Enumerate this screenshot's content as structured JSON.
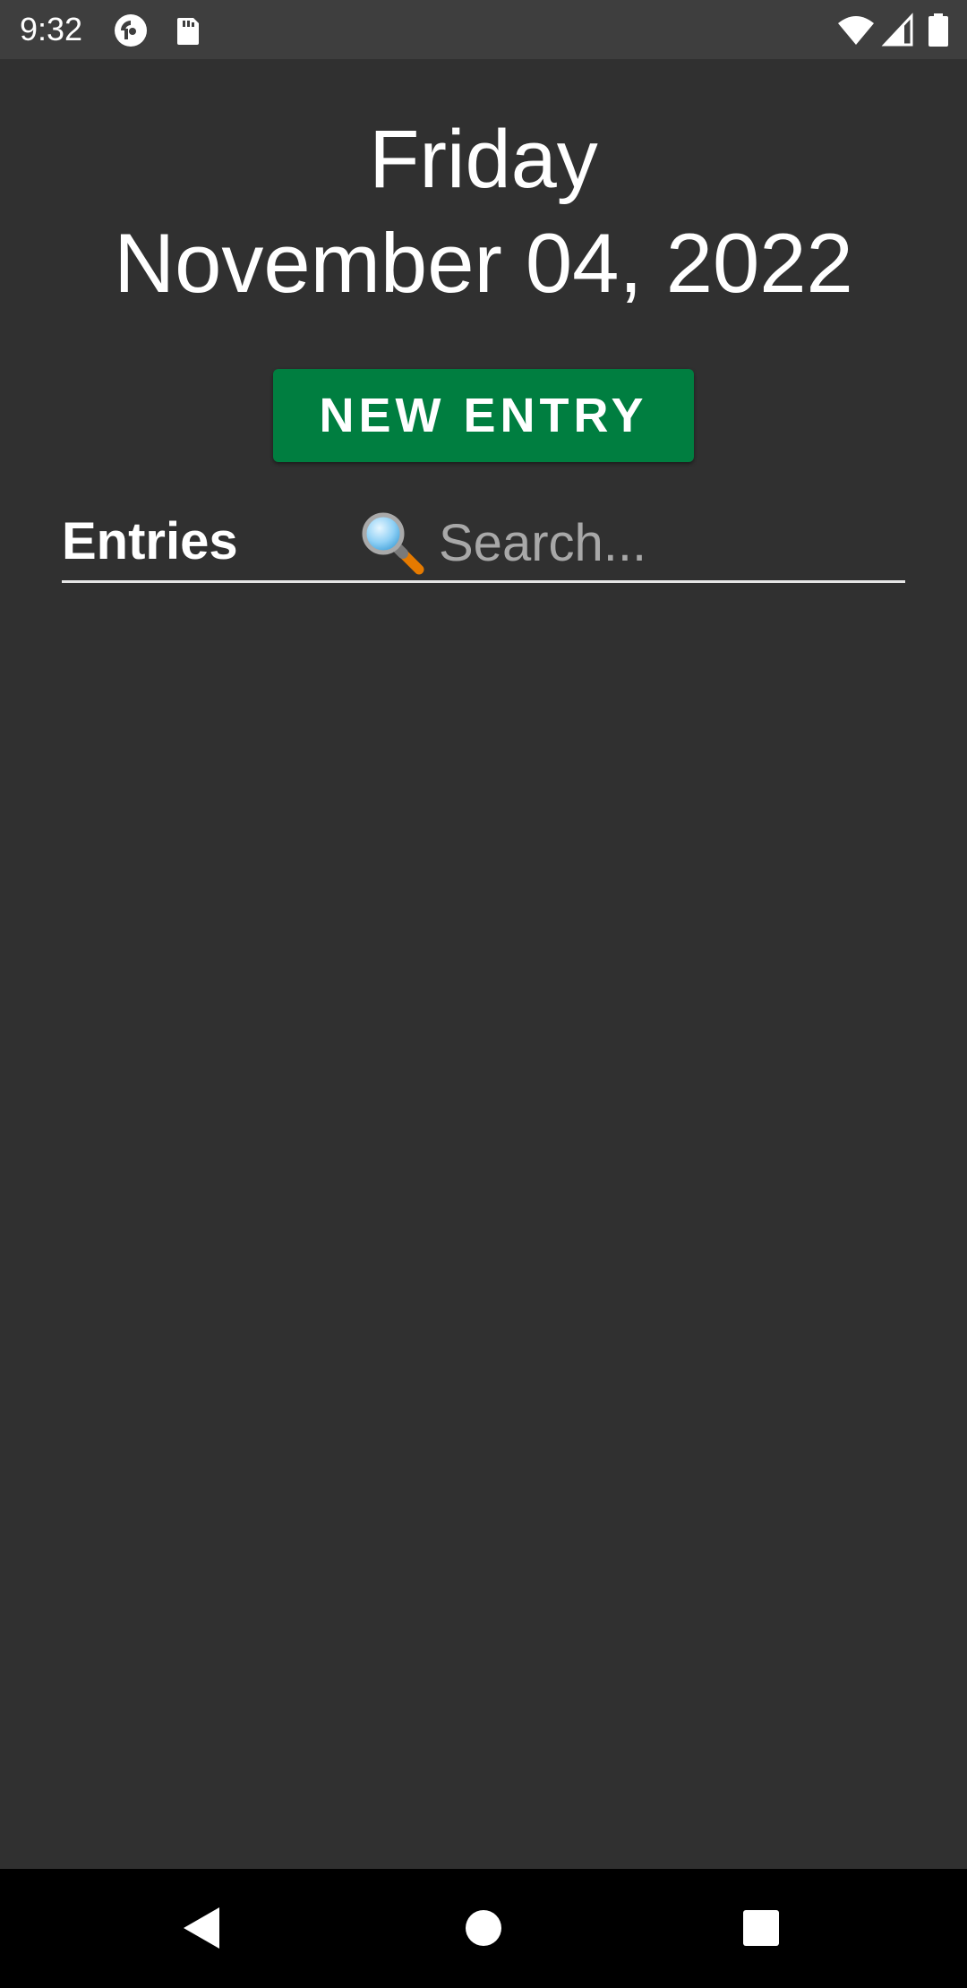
{
  "status_bar": {
    "time": "9:32",
    "icons": [
      "pocket-casts-icon",
      "sd-card-icon",
      "wifi-icon",
      "signal-icon",
      "battery-icon"
    ]
  },
  "header": {
    "day": "Friday",
    "date": "November 04, 2022"
  },
  "new_entry_button": {
    "label": "NEW ENTRY",
    "color": "#007e40"
  },
  "entries": {
    "title": "Entries",
    "search_placeholder": "Search...",
    "search_value": "",
    "items": []
  },
  "nav_bar": {
    "buttons": [
      "back-icon",
      "home-icon",
      "recents-icon"
    ]
  },
  "colors": {
    "background": "#303030",
    "status_bar": "#3e3e3e",
    "nav_bar": "#000000",
    "accent": "#007e40"
  }
}
